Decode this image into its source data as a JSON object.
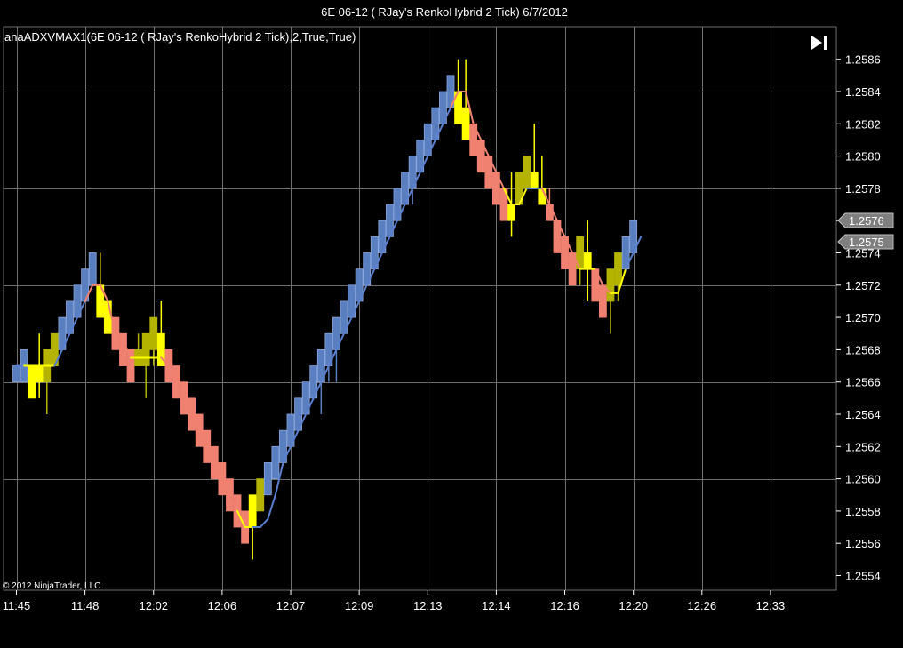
{
  "window_title": "6E 06-12 ( RJay's RenkoHybrid  2 Tick)  6/7/2012",
  "indicator_label": "anaADXVMAX1(6E 06-12 ( RJay's RenkoHybrid  2 Tick),2,True,True)",
  "copyright": "© 2012 NinjaTrader, LLC",
  "icons": {
    "scroll_end": "skip-to-end-icon"
  },
  "colors": {
    "background": "#000000",
    "grid": "#6e6e6e",
    "bull": "#5a7fc0",
    "bear": "#f08070",
    "neutral": "#ffff00",
    "neutral_dim": "#b4b400",
    "trend_up": "#5a7fd0",
    "trend_down": "#f08070",
    "trend_flat": "#ffff00",
    "price_tag": "#7f7f7f"
  },
  "chart_data": {
    "type": "candlestick",
    "title": "6E 06-12 ( RJay's RenkoHybrid  2 Tick)  6/7/2012",
    "brick_size": 0.0002,
    "ylim": [
      0.25535,
      0.25875
    ],
    "ytick_step": 0.0002,
    "y_ticks": [
      "1.2554",
      "1.2556",
      "1.2558",
      "1.2560",
      "1.2562",
      "1.2564",
      "1.2566",
      "1.2568",
      "1.2570",
      "1.2572",
      "1.2574",
      "1.2576",
      "1.2578",
      "1.2580",
      "1.2582",
      "1.2584",
      "1.2586"
    ],
    "x_tick_labels": [
      "11:45",
      "11:48",
      "12:02",
      "12:06",
      "12:07",
      "12:09",
      "12:13",
      "12:14",
      "12:16",
      "12:20",
      "12:26",
      "12:33"
    ],
    "x_tick_bar_index": [
      0,
      9,
      18,
      27,
      36,
      45,
      54,
      63,
      72,
      81,
      90,
      99
    ],
    "grid": true,
    "legend": "none",
    "price_tags": [
      "1.2576",
      "1.2575"
    ],
    "bars": [
      {
        "open": 1.2566,
        "high": 1.2567,
        "low": 1.2566,
        "close": 1.2567,
        "color": "bull"
      },
      {
        "open": 1.2566,
        "high": 1.2568,
        "low": 1.2566,
        "close": 1.2568,
        "color": "bull"
      },
      {
        "open": 1.2567,
        "high": 1.2567,
        "low": 1.2565,
        "close": 1.2565,
        "color": "neutral"
      },
      {
        "open": 1.2566,
        "high": 1.2569,
        "low": 1.2565,
        "close": 1.2567,
        "color": "neutral"
      },
      {
        "open": 1.2566,
        "high": 1.2568,
        "low": 1.2564,
        "close": 1.2568,
        "color": "neutral_dim"
      },
      {
        "open": 1.2567,
        "high": 1.2569,
        "low": 1.2567,
        "close": 1.2569,
        "color": "neutral_dim"
      },
      {
        "open": 1.2568,
        "high": 1.257,
        "low": 1.2568,
        "close": 1.257,
        "color": "bull"
      },
      {
        "open": 1.2569,
        "high": 1.2571,
        "low": 1.2569,
        "close": 1.2571,
        "color": "bull"
      },
      {
        "open": 1.257,
        "high": 1.2572,
        "low": 1.257,
        "close": 1.2572,
        "color": "bull"
      },
      {
        "open": 1.2571,
        "high": 1.2573,
        "low": 1.2571,
        "close": 1.2573,
        "color": "bull"
      },
      {
        "open": 1.2572,
        "high": 1.2574,
        "low": 1.2572,
        "close": 1.2574,
        "color": "bull"
      },
      {
        "open": 1.2572,
        "high": 1.2574,
        "low": 1.257,
        "close": 1.257,
        "color": "neutral"
      },
      {
        "open": 1.2571,
        "high": 1.2571,
        "low": 1.2569,
        "close": 1.2569,
        "color": "neutral"
      },
      {
        "open": 1.257,
        "high": 1.257,
        "low": 1.2568,
        "close": 1.2568,
        "color": "bear"
      },
      {
        "open": 1.2569,
        "high": 1.2569,
        "low": 1.2567,
        "close": 1.2567,
        "color": "bear"
      },
      {
        "open": 1.2568,
        "high": 1.2568,
        "low": 1.2566,
        "close": 1.2566,
        "color": "bear"
      },
      {
        "open": 1.2567,
        "high": 1.2569,
        "low": 1.2567,
        "close": 1.2568,
        "color": "neutral_dim"
      },
      {
        "open": 1.2567,
        "high": 1.2569,
        "low": 1.2565,
        "close": 1.2569,
        "color": "neutral_dim"
      },
      {
        "open": 1.2568,
        "high": 1.257,
        "low": 1.2567,
        "close": 1.257,
        "color": "neutral_dim"
      },
      {
        "open": 1.2569,
        "high": 1.2571,
        "low": 1.2567,
        "close": 1.2567,
        "color": "neutral"
      },
      {
        "open": 1.2568,
        "high": 1.2568,
        "low": 1.2566,
        "close": 1.2566,
        "color": "bear"
      },
      {
        "open": 1.2567,
        "high": 1.2567,
        "low": 1.2565,
        "close": 1.2565,
        "color": "bear"
      },
      {
        "open": 1.2566,
        "high": 1.2566,
        "low": 1.2564,
        "close": 1.2564,
        "color": "bear"
      },
      {
        "open": 1.2565,
        "high": 1.2565,
        "low": 1.2563,
        "close": 1.2563,
        "color": "bear"
      },
      {
        "open": 1.2564,
        "high": 1.2564,
        "low": 1.2562,
        "close": 1.2562,
        "color": "bear"
      },
      {
        "open": 1.2563,
        "high": 1.2563,
        "low": 1.2561,
        "close": 1.2561,
        "color": "bear"
      },
      {
        "open": 1.2562,
        "high": 1.2562,
        "low": 1.256,
        "close": 1.256,
        "color": "bear"
      },
      {
        "open": 1.2561,
        "high": 1.2561,
        "low": 1.2559,
        "close": 1.2559,
        "color": "bear"
      },
      {
        "open": 1.256,
        "high": 1.256,
        "low": 1.2558,
        "close": 1.2558,
        "color": "bear"
      },
      {
        "open": 1.2559,
        "high": 1.2559,
        "low": 1.2557,
        "close": 1.2557,
        "color": "bear"
      },
      {
        "open": 1.2558,
        "high": 1.2558,
        "low": 1.2556,
        "close": 1.2556,
        "color": "bear"
      },
      {
        "open": 1.2557,
        "high": 1.2559,
        "low": 1.2555,
        "close": 1.2559,
        "color": "neutral"
      },
      {
        "open": 1.2558,
        "high": 1.256,
        "low": 1.2558,
        "close": 1.256,
        "color": "neutral_dim"
      },
      {
        "open": 1.2559,
        "high": 1.2561,
        "low": 1.2559,
        "close": 1.2561,
        "color": "bull"
      },
      {
        "open": 1.256,
        "high": 1.2562,
        "low": 1.256,
        "close": 1.2562,
        "color": "bull"
      },
      {
        "open": 1.2561,
        "high": 1.2563,
        "low": 1.2561,
        "close": 1.2563,
        "color": "bull"
      },
      {
        "open": 1.2562,
        "high": 1.2564,
        "low": 1.2562,
        "close": 1.2564,
        "color": "bull"
      },
      {
        "open": 1.2563,
        "high": 1.2565,
        "low": 1.2563,
        "close": 1.2565,
        "color": "bull"
      },
      {
        "open": 1.2564,
        "high": 1.2566,
        "low": 1.2564,
        "close": 1.2566,
        "color": "bull"
      },
      {
        "open": 1.2565,
        "high": 1.2567,
        "low": 1.2565,
        "close": 1.2567,
        "color": "bull"
      },
      {
        "open": 1.2566,
        "high": 1.2568,
        "low": 1.2564,
        "close": 1.2568,
        "color": "bull"
      },
      {
        "open": 1.2567,
        "high": 1.2569,
        "low": 1.2566,
        "close": 1.2569,
        "color": "bull"
      },
      {
        "open": 1.2568,
        "high": 1.257,
        "low": 1.2566,
        "close": 1.257,
        "color": "bull"
      },
      {
        "open": 1.2569,
        "high": 1.2571,
        "low": 1.2569,
        "close": 1.2571,
        "color": "bull"
      },
      {
        "open": 1.257,
        "high": 1.2572,
        "low": 1.257,
        "close": 1.2572,
        "color": "bull"
      },
      {
        "open": 1.2571,
        "high": 1.2573,
        "low": 1.2571,
        "close": 1.2573,
        "color": "bull"
      },
      {
        "open": 1.2572,
        "high": 1.2574,
        "low": 1.2572,
        "close": 1.2574,
        "color": "bull"
      },
      {
        "open": 1.2573,
        "high": 1.2575,
        "low": 1.2573,
        "close": 1.2575,
        "color": "bull"
      },
      {
        "open": 1.2574,
        "high": 1.2576,
        "low": 1.2574,
        "close": 1.2576,
        "color": "bull"
      },
      {
        "open": 1.2575,
        "high": 1.2577,
        "low": 1.2575,
        "close": 1.2577,
        "color": "bull"
      },
      {
        "open": 1.2576,
        "high": 1.2578,
        "low": 1.2576,
        "close": 1.2578,
        "color": "bull"
      },
      {
        "open": 1.2577,
        "high": 1.2579,
        "low": 1.2577,
        "close": 1.2579,
        "color": "bull"
      },
      {
        "open": 1.2578,
        "high": 1.258,
        "low": 1.2577,
        "close": 1.258,
        "color": "bull"
      },
      {
        "open": 1.2579,
        "high": 1.2581,
        "low": 1.2579,
        "close": 1.2581,
        "color": "bull"
      },
      {
        "open": 1.258,
        "high": 1.2582,
        "low": 1.258,
        "close": 1.2582,
        "color": "bull"
      },
      {
        "open": 1.2581,
        "high": 1.2583,
        "low": 1.2581,
        "close": 1.2583,
        "color": "bull"
      },
      {
        "open": 1.2582,
        "high": 1.2584,
        "low": 1.2582,
        "close": 1.2584,
        "color": "bull"
      },
      {
        "open": 1.2583,
        "high": 1.2585,
        "low": 1.2583,
        "close": 1.2585,
        "color": "bull"
      },
      {
        "open": 1.2584,
        "high": 1.2586,
        "low": 1.2582,
        "close": 1.2582,
        "color": "neutral"
      },
      {
        "open": 1.2583,
        "high": 1.2586,
        "low": 1.2581,
        "close": 1.2581,
        "color": "neutral"
      },
      {
        "open": 1.2582,
        "high": 1.2582,
        "low": 1.258,
        "close": 1.258,
        "color": "bear"
      },
      {
        "open": 1.2581,
        "high": 1.2581,
        "low": 1.2579,
        "close": 1.2579,
        "color": "bear"
      },
      {
        "open": 1.258,
        "high": 1.258,
        "low": 1.2578,
        "close": 1.2578,
        "color": "bear"
      },
      {
        "open": 1.2579,
        "high": 1.2579,
        "low": 1.2577,
        "close": 1.2577,
        "color": "bear"
      },
      {
        "open": 1.2578,
        "high": 1.2578,
        "low": 1.2576,
        "close": 1.2576,
        "color": "bear"
      },
      {
        "open": 1.2577,
        "high": 1.2579,
        "low": 1.2575,
        "close": 1.2576,
        "color": "neutral"
      },
      {
        "open": 1.2577,
        "high": 1.2579,
        "low": 1.2577,
        "close": 1.2579,
        "color": "neutral_dim"
      },
      {
        "open": 1.2578,
        "high": 1.258,
        "low": 1.2578,
        "close": 1.258,
        "color": "neutral_dim"
      },
      {
        "open": 1.2579,
        "high": 1.2582,
        "low": 1.2578,
        "close": 1.2578,
        "color": "neutral"
      },
      {
        "open": 1.2578,
        "high": 1.258,
        "low": 1.2577,
        "close": 1.2577,
        "color": "neutral"
      },
      {
        "open": 1.2577,
        "high": 1.2578,
        "low": 1.2576,
        "close": 1.2576,
        "color": "bear"
      },
      {
        "open": 1.2576,
        "high": 1.2576,
        "low": 1.2574,
        "close": 1.2574,
        "color": "bear"
      },
      {
        "open": 1.2575,
        "high": 1.2575,
        "low": 1.2573,
        "close": 1.2573,
        "color": "bear"
      },
      {
        "open": 1.2574,
        "high": 1.2574,
        "low": 1.2572,
        "close": 1.2572,
        "color": "bear"
      },
      {
        "open": 1.2573,
        "high": 1.2575,
        "low": 1.2572,
        "close": 1.2575,
        "color": "neutral_dim"
      },
      {
        "open": 1.2574,
        "high": 1.2576,
        "low": 1.2571,
        "close": 1.2573,
        "color": "neutral"
      },
      {
        "open": 1.2573,
        "high": 1.2573,
        "low": 1.2571,
        "close": 1.2571,
        "color": "bear"
      },
      {
        "open": 1.2572,
        "high": 1.2572,
        "low": 1.257,
        "close": 1.257,
        "color": "bear"
      },
      {
        "open": 1.2571,
        "high": 1.2573,
        "low": 1.2569,
        "close": 1.2573,
        "color": "neutral_dim"
      },
      {
        "open": 1.2572,
        "high": 1.2574,
        "low": 1.2571,
        "close": 1.2574,
        "color": "neutral_dim"
      },
      {
        "open": 1.2573,
        "high": 1.2575,
        "low": 1.2573,
        "close": 1.2575,
        "color": "bull"
      },
      {
        "open": 1.2574,
        "high": 1.2576,
        "low": 1.2574,
        "close": 1.2576,
        "color": "bull"
      }
    ],
    "trend_line": [
      1.2567,
      1.2567,
      1.2567,
      1.2567,
      1.2567,
      1.2567,
      1.2568,
      1.2569,
      1.257,
      1.2571,
      1.2572,
      1.2572,
      1.2571,
      1.2569,
      1.25685,
      1.25675,
      1.25675,
      1.25675,
      1.25675,
      1.25675,
      1.2567,
      1.2566,
      1.2565,
      1.2564,
      1.2563,
      1.2562,
      1.2561,
      1.256,
      1.2559,
      1.2558,
      1.2557,
      1.2557,
      1.2557,
      1.25575,
      1.2559,
      1.2561,
      1.2562,
      1.2563,
      1.2564,
      1.2565,
      1.2566,
      1.2567,
      1.2568,
      1.2569,
      1.257,
      1.2571,
      1.2572,
      1.2573,
      1.2574,
      1.2575,
      1.2576,
      1.2577,
      1.2578,
      1.2579,
      1.258,
      1.2581,
      1.2582,
      1.2583,
      1.2584,
      1.2584,
      1.2582,
      1.2581,
      1.258,
      1.2579,
      1.2578,
      1.2577,
      1.2577,
      1.2578,
      1.2578,
      1.2578,
      1.2577,
      1.2576,
      1.2575,
      1.2574,
      1.2573,
      1.2573,
      1.2573,
      1.2572,
      1.25715,
      1.25715,
      1.2573,
      1.2574,
      1.2575
    ],
    "trend_color": [
      "up",
      "up",
      "flat",
      "flat",
      "flat",
      "flat",
      "up",
      "up",
      "up",
      "up",
      "down",
      "down",
      "down",
      "down",
      "down",
      "down",
      "flat",
      "flat",
      "flat",
      "flat",
      "down",
      "down",
      "down",
      "down",
      "down",
      "down",
      "down",
      "down",
      "down",
      "down",
      "flat",
      "flat",
      "up",
      "up",
      "up",
      "up",
      "up",
      "up",
      "up",
      "up",
      "up",
      "up",
      "up",
      "up",
      "up",
      "up",
      "up",
      "up",
      "up",
      "up",
      "up",
      "up",
      "up",
      "up",
      "up",
      "up",
      "up",
      "up",
      "down",
      "down",
      "down",
      "down",
      "down",
      "down",
      "down",
      "flat",
      "flat",
      "flat",
      "up",
      "up",
      "down",
      "down",
      "down",
      "down",
      "down",
      "flat",
      "flat",
      "down",
      "down",
      "flat",
      "flat",
      "up",
      "up",
      "up"
    ]
  }
}
